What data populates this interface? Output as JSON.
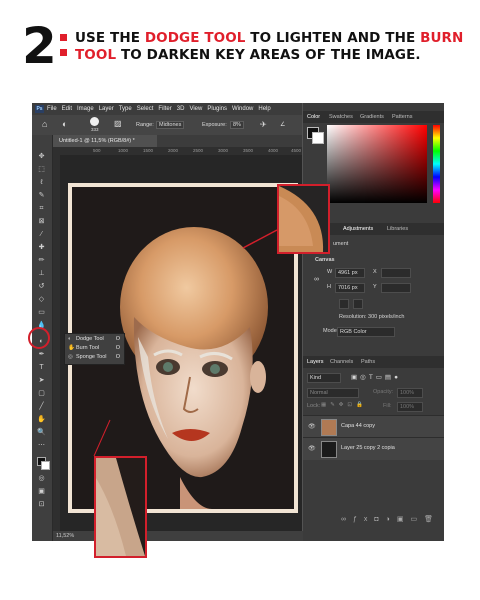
{
  "headline": {
    "number": "2",
    "line1_a": "USE THE ",
    "line1_b": "DODGE TOOL",
    "line1_c": " TO LIGHTEN AND THE ",
    "line1_d": "BURN",
    "line2_a": "TOOL",
    "line2_b": " TO DARKEN KEY AREAS OF THE IMAGE."
  },
  "photoshop": {
    "logo": "Ps",
    "menu": [
      "File",
      "Edit",
      "Image",
      "Layer",
      "Type",
      "Select",
      "Filter",
      "3D",
      "View",
      "Plugins",
      "Window",
      "Help"
    ],
    "options": {
      "brush_size": "333",
      "range_label": "Range:",
      "range_value": "Midtones",
      "exposure_label": "Exposure:",
      "exposure_value": "8%"
    },
    "doc_tab": "Untitled-1 @ 11,5% (RGB/8#) *",
    "ruler_ticks": [
      "500",
      "1000",
      "1500",
      "2000",
      "2500",
      "3000",
      "3500",
      "4000",
      "4500"
    ],
    "status_zoom": "11,52%",
    "tool_flyout": [
      {
        "label": "Dodge Tool",
        "key": "O"
      },
      {
        "label": "Burn Tool",
        "key": "O"
      },
      {
        "label": "Sponge Tool",
        "key": "O"
      }
    ],
    "panels": {
      "color_tabs": [
        "Color",
        "Swatches",
        "Gradients",
        "Patterns"
      ],
      "props_tabs": [
        "Adjustments",
        "Libraries"
      ],
      "props_section": "ument",
      "canvas_title": "Canvas",
      "w_label": "W",
      "w_value": "4961 px",
      "x_label": "X",
      "h_label": "H",
      "h_value": "7016 px",
      "y_label": "Y",
      "resolution": "Resolution: 300 pixels/inch",
      "mode_label": "Mode",
      "mode_value": "RGB Color",
      "layers_tabs": [
        "Layers",
        "Channels",
        "Paths"
      ],
      "kind_value": "Kind",
      "blend_mode": "Normal",
      "opacity_label": "Opacity:",
      "opacity_value": "100%",
      "lock_label": "Lock:",
      "fill_label": "Fill:",
      "fill_value": "100%",
      "layers": [
        {
          "name": "Capa 44 copy"
        },
        {
          "name": "Layer 25 copy 2 copia"
        }
      ]
    }
  },
  "colors": {
    "accent_red": "#e01f2b",
    "ps_dark": "#535353",
    "panel": "#3b3b3b"
  }
}
